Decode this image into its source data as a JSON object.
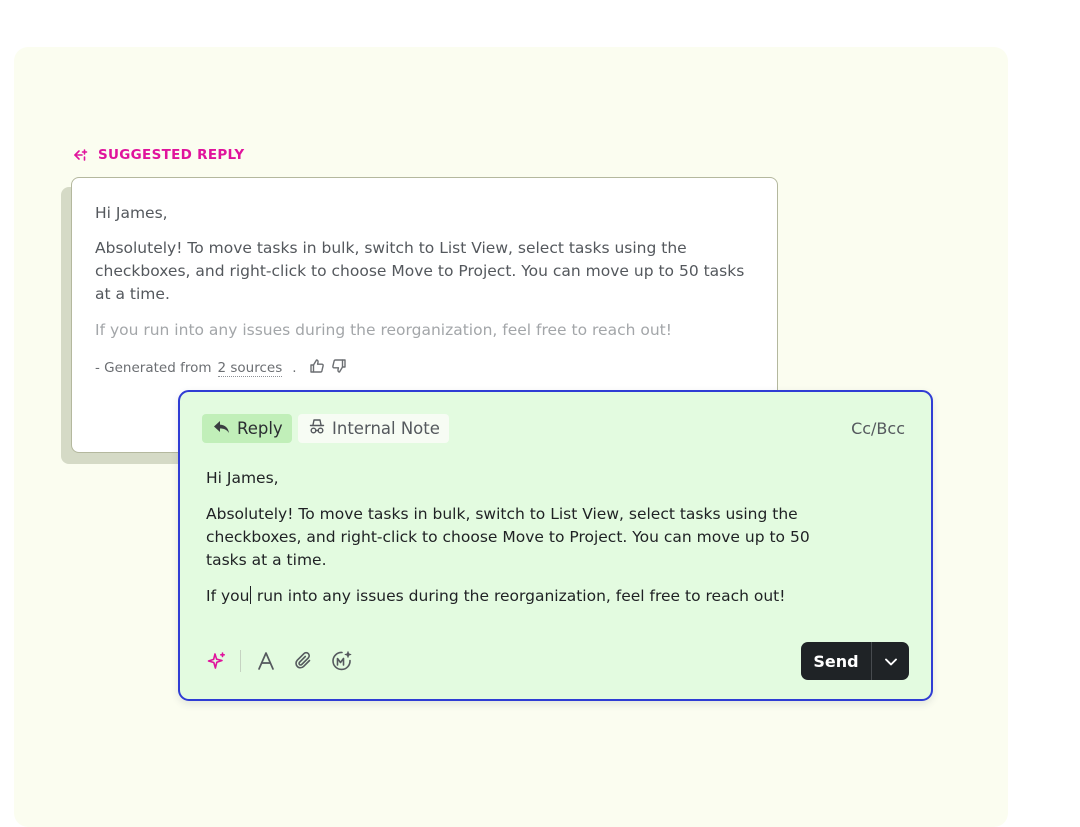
{
  "suggested": {
    "label": "SUGGESTED REPLY",
    "greeting": "Hi James,",
    "body": "Absolutely! To move tasks in bulk, switch to List View, select tasks using the checkboxes, and right-click to choose Move to Project. You can move up to 50 tasks at a time.",
    "closing": "If you run into any issues during the reorganization, feel free to reach out!",
    "generated_prefix": "- Generated from",
    "sources_link": "2 sources",
    "generated_suffix": ".",
    "icons": [
      "suggested-reply-icon",
      "thumbs-up-icon",
      "thumbs-down-icon"
    ]
  },
  "composer": {
    "tabs": [
      {
        "label": "Reply",
        "icon": "reply-arrow-icon",
        "active": true
      },
      {
        "label": "Internal Note",
        "icon": "incognito-icon",
        "active": false
      }
    ],
    "cc_bcc": "Cc/Bcc",
    "greeting": "Hi James,",
    "body": "Absolutely! To move tasks in bulk, switch to List View, select tasks using the checkboxes, and right-click to choose Move to Project. You can move up to 50 tasks at a time.",
    "closing_before_caret": "If you",
    "closing_after_caret": " run into any issues during the reorganization, feel free to reach out!",
    "toolbar_icons": [
      "ai-sparkle-icon",
      "text-format-icon",
      "attachment-icon",
      "macro-icon"
    ],
    "send_label": "Send",
    "send_menu_icon": "chevron-down-icon"
  },
  "colors": {
    "accent_pink": "#e0139c",
    "composer_border": "#2f3cd4",
    "composer_bg": "#e3fbe0",
    "reply_tab_bg": "#c1efb9",
    "send_bg": "#1f2326"
  }
}
